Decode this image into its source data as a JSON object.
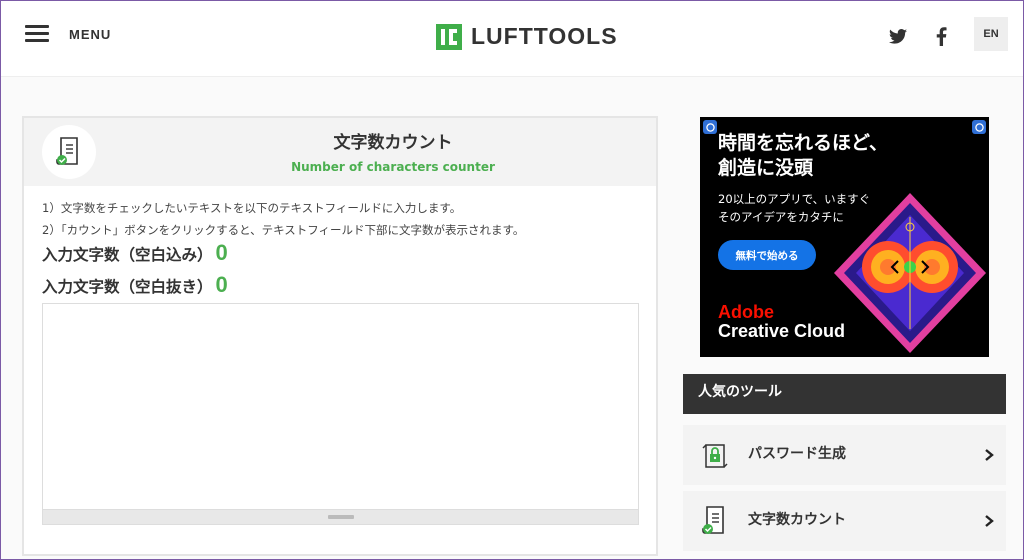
{
  "header": {
    "menu_label": "MENU",
    "logo_text": "LUFTTOOLS",
    "lang_label": "EN",
    "brand_color": "#3fae49"
  },
  "tool": {
    "title": "文字数カウント",
    "subtitle": "Number of characters counter",
    "instructions": [
      "1）文字数をチェックしたいテキストを以下のテキストフィールドに入力します。",
      "2）「カウント」ボタンをクリックすると、テキストフィールド下部に文字数が表示されます。"
    ],
    "count_with_spaces_label": "入力文字数（空白込み）",
    "count_with_spaces_value": "0",
    "count_without_spaces_label": "入力文字数（空白抜き）",
    "count_without_spaces_value": "0",
    "textarea_value": ""
  },
  "ad": {
    "headline_line1": "時間を忘れるほど、",
    "headline_line2": "創造に没頭",
    "sub_line1": "20以上のアプリで、いますぐ",
    "sub_line2": "そのアイデアをカタチに",
    "cta_label": "無料で始める",
    "brand_line1": "Adobe",
    "brand_line2": "Creative Cloud"
  },
  "popular": {
    "heading": "人気のツール",
    "items": [
      {
        "label": "パスワード生成",
        "icon": "lock-refresh-icon"
      },
      {
        "label": "文字数カウント",
        "icon": "document-check-icon"
      }
    ]
  },
  "colors": {
    "accent_green": "#4caf50",
    "dark_header": "#333333",
    "ad_blue": "#1473e6",
    "adobe_red": "#fa0f00"
  }
}
